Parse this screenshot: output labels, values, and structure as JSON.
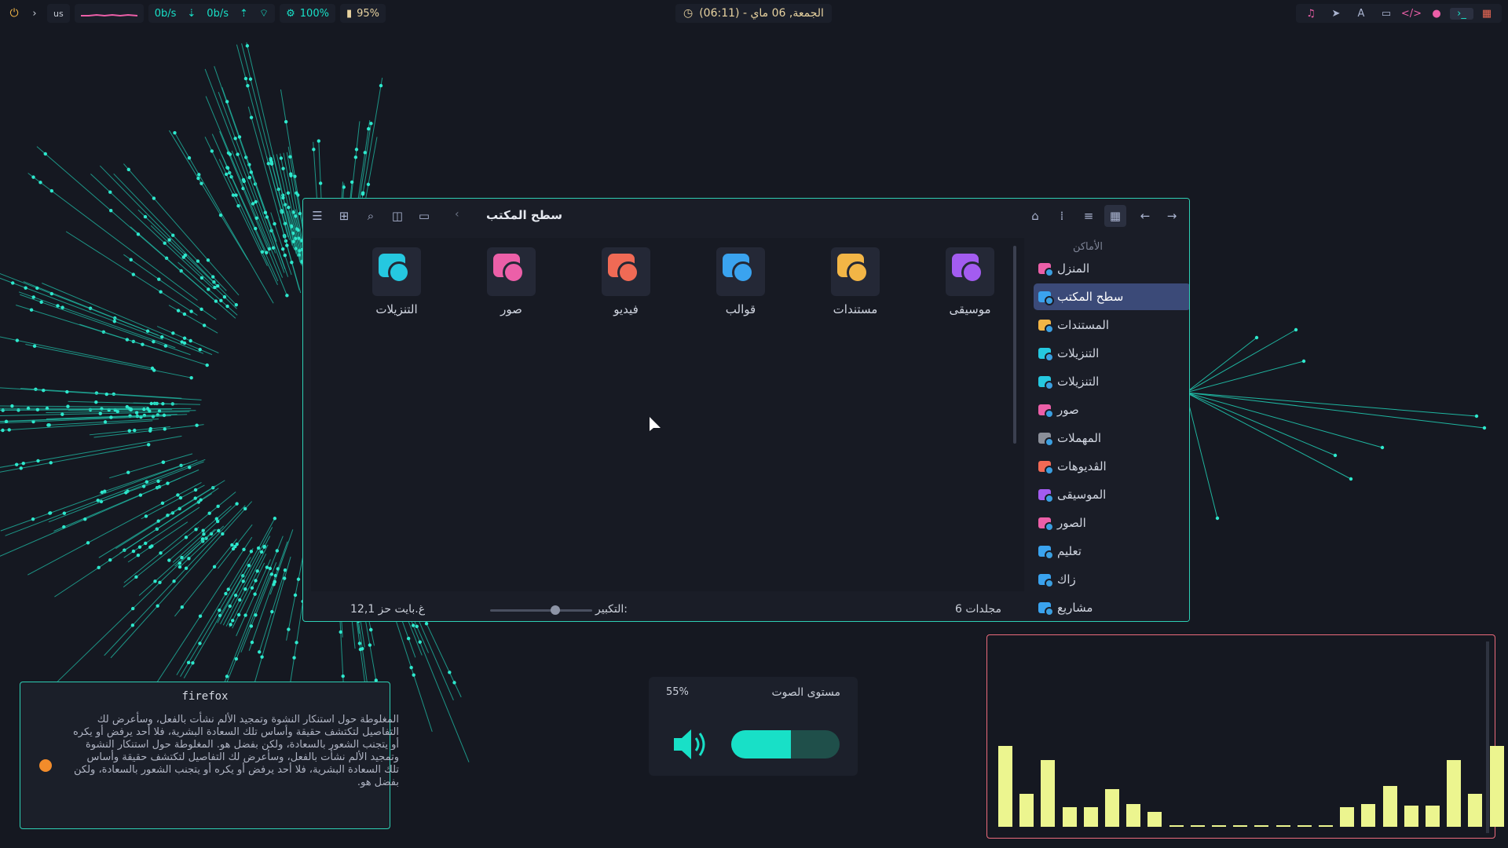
{
  "topbar": {
    "layout": "us",
    "net_down": "0b/s",
    "net_up": "0b/s",
    "cpu": "100%",
    "battery": "95%",
    "clock": "(06:11) - الجمعة, 06 ماي",
    "colors": {
      "accent": "#2ecfb4",
      "pink": "#ec5fa8",
      "yellow": "#e8d3a0"
    }
  },
  "file_manager": {
    "path_title": "سطح المكتب",
    "files": [
      {
        "label": "موسيقى",
        "color": "#a35cf0",
        "icon": "music-folder-icon"
      },
      {
        "label": "مستندات",
        "color": "#f2b546",
        "icon": "documents-folder-icon"
      },
      {
        "label": "قوالب",
        "color": "#3aa3ef",
        "icon": "templates-folder-icon"
      },
      {
        "label": "فيديو",
        "color": "#f06a55",
        "icon": "video-folder-icon"
      },
      {
        "label": "صور",
        "color": "#ec5fa8",
        "icon": "pictures-folder-icon"
      },
      {
        "label": "التنزيلات",
        "color": "#25c8e0",
        "icon": "downloads-folder-icon"
      }
    ],
    "sidebar_heading": "الأماكن",
    "sidebar_items": [
      {
        "label": "المنزل",
        "color": "#ec5fa8"
      },
      {
        "label": "سطح المكتب",
        "color": "#3aa3ef",
        "selected": true
      },
      {
        "label": "المستندات",
        "color": "#f2b546"
      },
      {
        "label": "التنزيلات",
        "color": "#25c8e0"
      },
      {
        "label": "التنزيلات",
        "color": "#25c8e0"
      },
      {
        "label": "صور",
        "color": "#ec5fa8"
      },
      {
        "label": "المهملات",
        "color": "#8b8f99"
      },
      {
        "label": "الڤديوهات",
        "color": "#f06a55"
      },
      {
        "label": "الموسيقى",
        "color": "#a35cf0"
      },
      {
        "label": "الصور",
        "color": "#ec5fa8"
      },
      {
        "label": "تعليم",
        "color": "#3aa3ef"
      },
      {
        "label": "زاك",
        "color": "#3aa3ef"
      },
      {
        "label": "مشاريع",
        "color": "#3aa3ef"
      }
    ],
    "status_size": "12,1 غ.بايت حز",
    "zoom_label": "التكبير:",
    "zoom_level": 0.62,
    "status_count": "6 مجلدات"
  },
  "notification": {
    "title": "firefox",
    "body": "المغلوطة حول استنكار النشوة وتمجيد الألم نشأت بالفعل، وسأعرض لك التفاصيل لتكتشف حقيقة وأساس تلك السعادة البشرية، فلا أحد يرفض أو يكره أو يتجنب الشعور بالسعادة، ولكن بفضل هو. المغلوطة حول استنكار النشوة وتمجيد الألم نشأت بالفعل، وسأعرض لك التفاصيل لتكتشف حقيقة وأساس تلك السعادة البشرية، فلا أحد يرفض أو يكره أو يتجنب الشعور بالسعادة، ولكن بفضل هو."
  },
  "volume": {
    "title": "مستوى الصوت",
    "percent_text": "55%",
    "level": 0.55
  },
  "visualizer": {
    "levels": [
      0.99,
      0.4,
      0.82,
      0.24,
      0.24,
      0.46,
      0.28,
      0.18,
      0.02,
      0.02,
      0.02,
      0.02,
      0.02,
      0.02,
      0.02,
      0.02,
      0.24,
      0.28,
      0.5,
      0.26,
      0.26,
      0.82,
      0.4,
      0.99
    ]
  }
}
